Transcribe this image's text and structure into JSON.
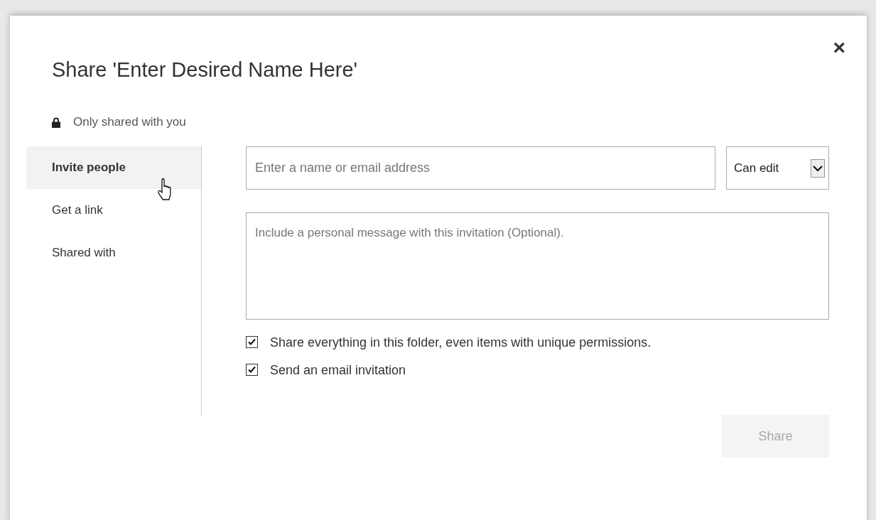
{
  "dialog": {
    "title": "Share 'Enter Desired Name Here'",
    "close": "×"
  },
  "sharing_status": "Only shared with you",
  "sidebar": {
    "items": [
      {
        "label": "Invite people",
        "selected": true
      },
      {
        "label": "Get a link",
        "selected": false
      },
      {
        "label": "Shared with",
        "selected": false
      }
    ]
  },
  "invite": {
    "name_field": {
      "placeholder": "Enter a name or email address"
    },
    "permission": {
      "value": "Can edit"
    },
    "message": {
      "placeholder": "Include a personal message with this invitation (Optional)."
    },
    "options": [
      {
        "label": "Share everything in this folder, even items with unique permissions.",
        "checked": true
      },
      {
        "label": "Send an email invitation",
        "checked": true
      }
    ],
    "share_button": {
      "label": "Share",
      "disabled": true
    }
  }
}
